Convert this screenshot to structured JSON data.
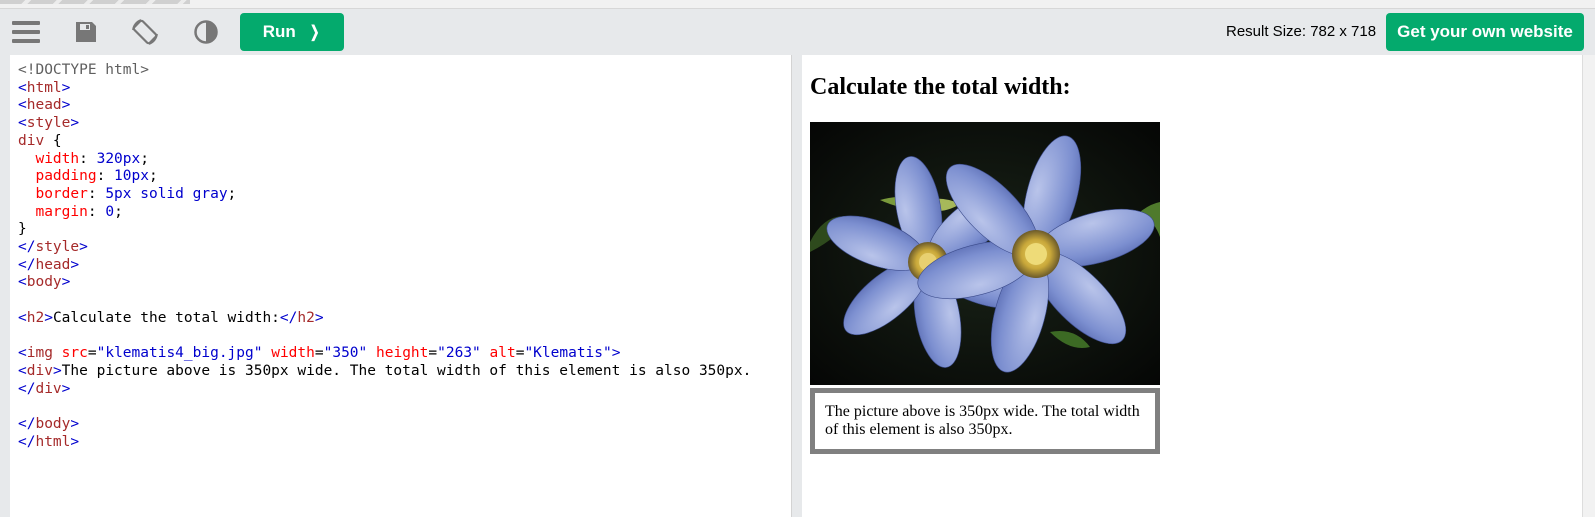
{
  "toolbar": {
    "menu_icon": "menu-icon",
    "save_icon": "save-icon",
    "rotate_icon": "rotate-icon",
    "contrast_icon": "contrast-icon",
    "run_label": "Run",
    "run_chevron": "❯",
    "result_size": "Result Size: 782 x 718",
    "own_website_label": "Get your own website"
  },
  "editor": {
    "code_lines": [
      "<!DOCTYPE html>",
      "<html>",
      "<head>",
      "<style>",
      "div {",
      "  width: 320px;",
      "  padding: 10px;",
      "  border: 5px solid gray;",
      "  margin: 0;",
      "}",
      "</style>",
      "</head>",
      "<body>",
      "",
      "<h2>Calculate the total width:</h2>",
      "",
      "<img src=\"klematis4_big.jpg\" width=\"350\" height=\"263\" alt=\"Klematis\">",
      "<div>The picture above is 350px wide. The total width of this element is also 350px.",
      "</div>",
      "",
      "</body>",
      "</html>"
    ]
  },
  "result": {
    "heading": "Calculate the total width:",
    "image_alt": "Klematis",
    "box_text": "The picture above is 350px wide. The total width of this element is also 350px."
  },
  "colors": {
    "accent_green": "#04aa6d",
    "toolbar_bg": "#e7e9eb",
    "tag_blue": "#0000cd",
    "tagname_brown": "#a52a2a",
    "attr_red": "#ff0000"
  }
}
